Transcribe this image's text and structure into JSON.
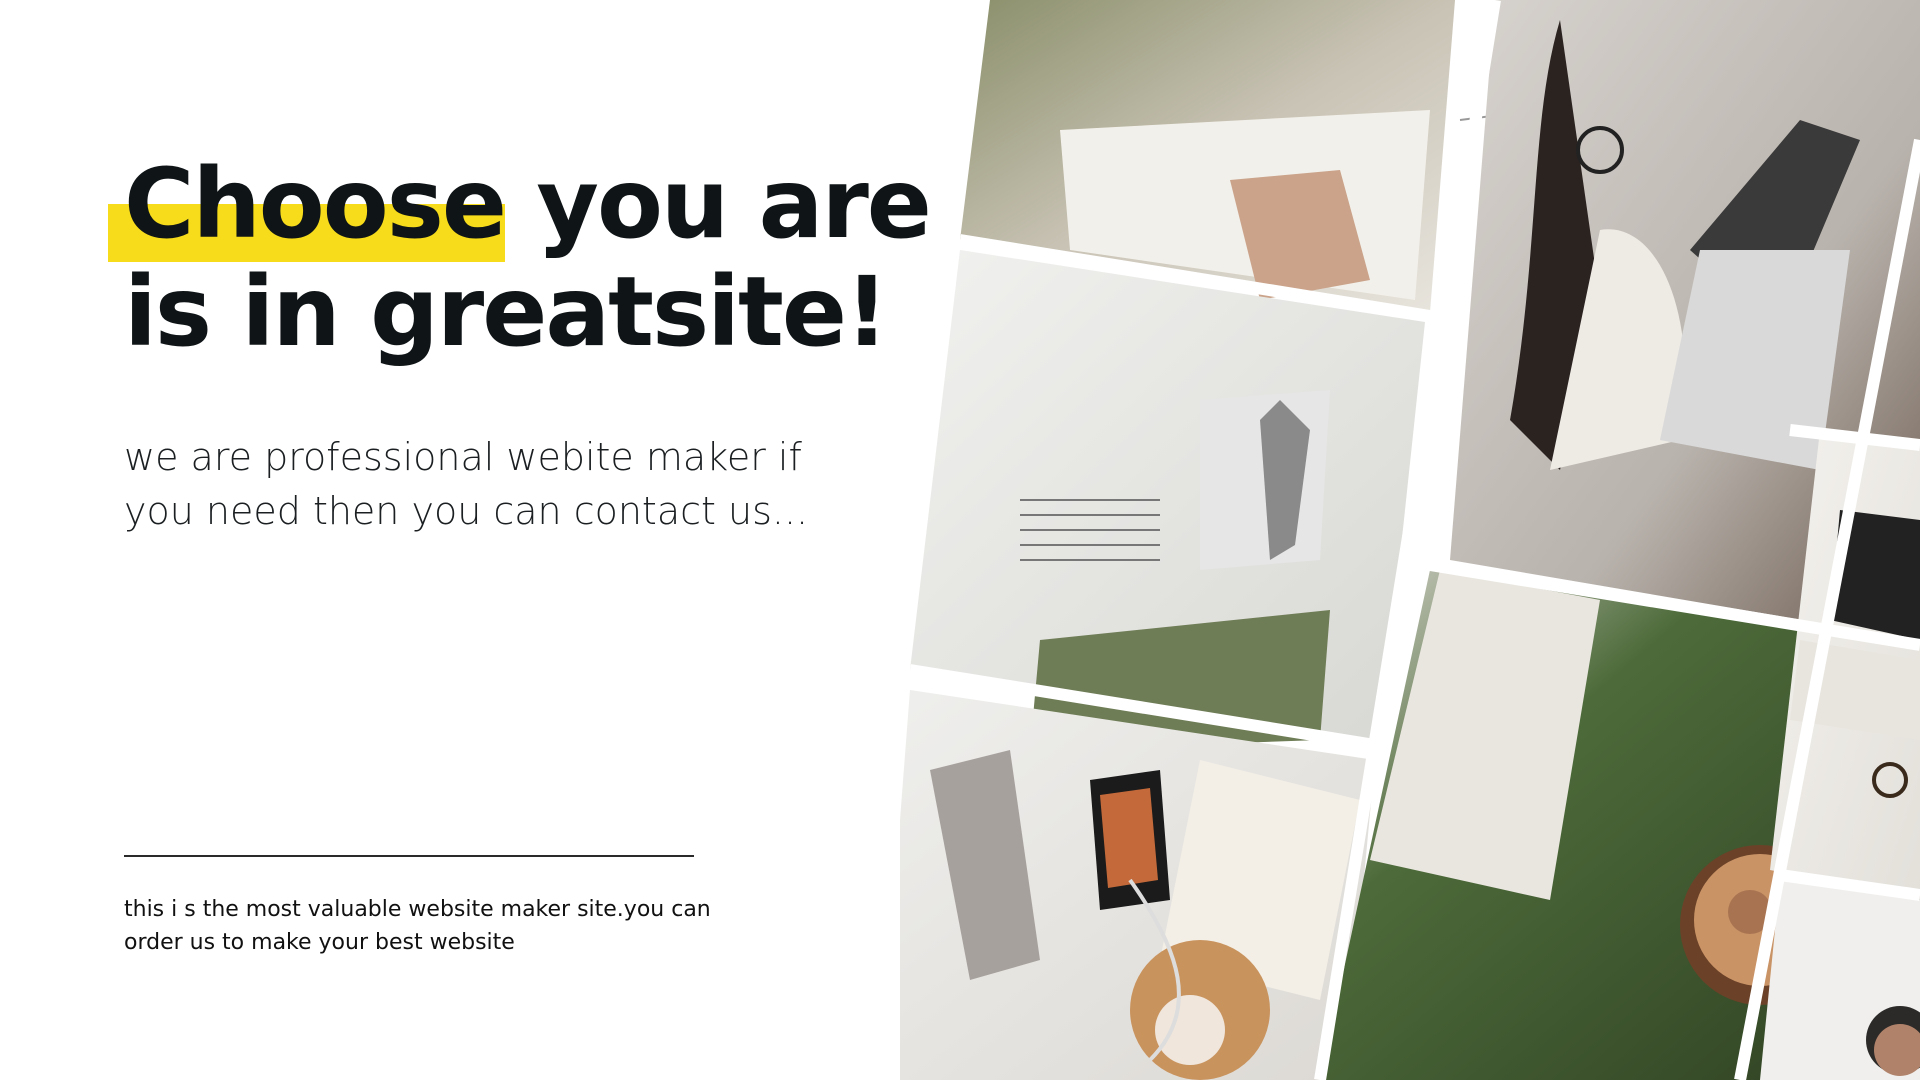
{
  "hero": {
    "headline_highlight": "Choose",
    "headline_rest_line1": " you are",
    "headline_line2": "is in greatsite!",
    "subtitle": "we are professional webite maker if you need then you can contact us...",
    "footer_text": "this i s  the most  valuable website maker site.you can\norder us to make your best  website"
  },
  "colors": {
    "highlight": "#f6dc1a",
    "text": "#0f1416"
  },
  "collage": {
    "photos": [
      "magazine-reading-photo",
      "woman-laptop-photo",
      "editorial-layout-photo",
      "desk-flatlay-photo",
      "coffee-magazine-photo",
      "books-glasses-photo",
      "person-portrait-photo"
    ]
  }
}
